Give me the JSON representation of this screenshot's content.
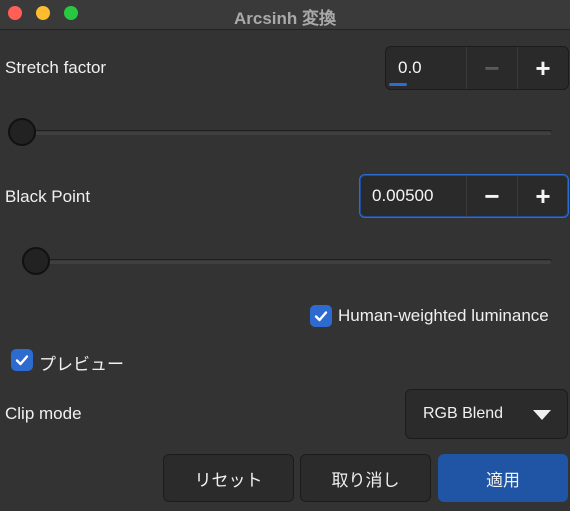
{
  "window": {
    "title": "Arcsinh 変換"
  },
  "stretch": {
    "label": "Stretch factor",
    "value": "0.0",
    "minus": "−",
    "plus": "+",
    "slider_fraction": 0.0
  },
  "black_point": {
    "label": "Black Point",
    "value": "0.00500",
    "minus": "−",
    "plus": "+",
    "slider_fraction": 0.0
  },
  "luminance": {
    "label": "Human-weighted luminance",
    "checked": true
  },
  "preview": {
    "label": "プレビュー",
    "checked": true
  },
  "clip_mode": {
    "label": "Clip mode",
    "selected": "RGB Blend"
  },
  "buttons": {
    "reset": "リセット",
    "cancel": "取り消し",
    "apply": "適用"
  },
  "colors": {
    "accent": "#2d6bd1",
    "apply_bg": "#1f55a4"
  }
}
